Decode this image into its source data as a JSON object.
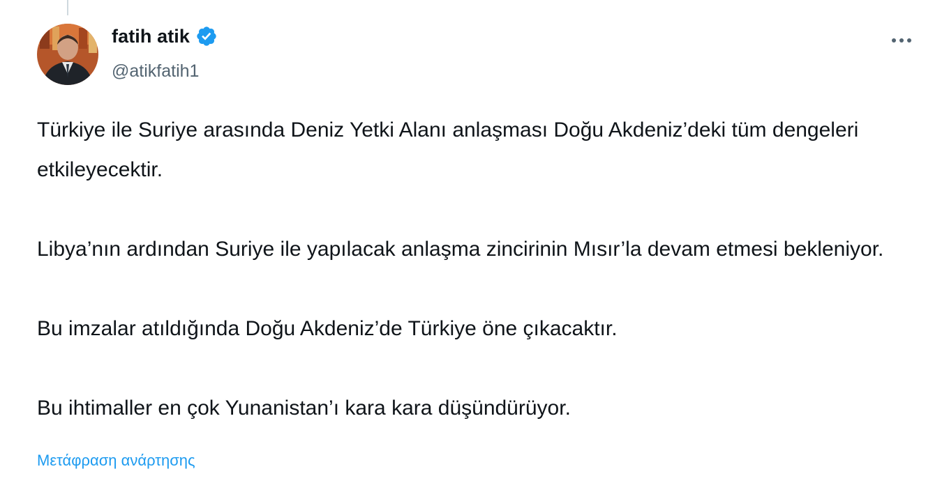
{
  "author": {
    "display_name": "fatih atik",
    "handle": "@atikfatih1",
    "verified": true,
    "avatar": "profile-photo"
  },
  "actions": {
    "more_icon": "more-horizontal-icon"
  },
  "tweet": {
    "paragraphs": [
      "Türkiye ile Suriye arasında Deniz Yetki Alanı anlaşması Doğu Akdeniz’deki tüm dengeleri etkileyecektir.",
      "Libya’nın ardından Suriye ile yapılacak anlaşma zincirinin Mısır’la devam etmesi bekleniyor.",
      "Bu imzalar atıldığında Doğu Akdeniz’de Türkiye öne çıkacaktır.",
      "Bu ihtimaller en çok Yunanistan’ı kara kara düşündürüyor."
    ],
    "translate_label": "Μετάφραση ανάρτησης"
  },
  "colors": {
    "text_primary": "#0f1419",
    "text_secondary": "#536471",
    "accent": "#1d9bf0",
    "divider": "#cfd9de"
  }
}
